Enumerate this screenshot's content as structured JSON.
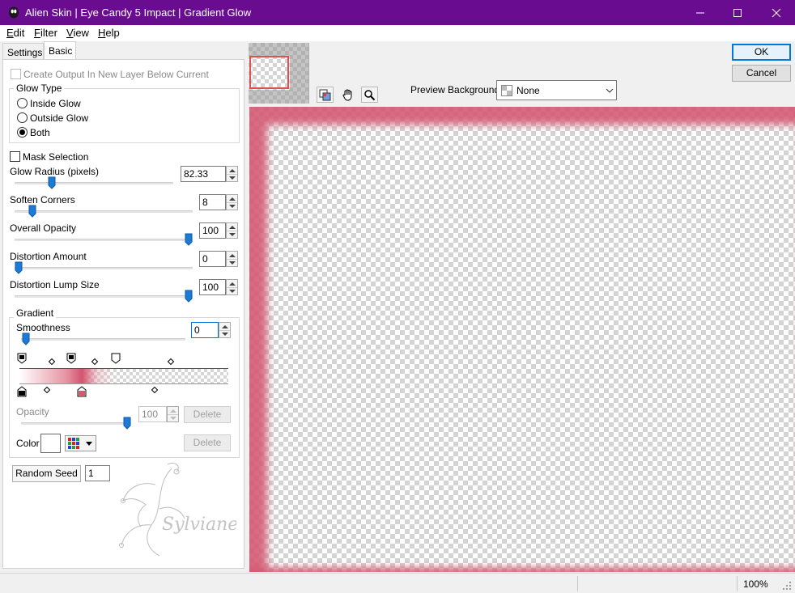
{
  "window": {
    "title": "Alien Skin | Eye Candy 5 Impact | Gradient Glow",
    "titlebar_color": "#6a0c8f"
  },
  "menu": [
    "Edit",
    "Filter",
    "View",
    "Help"
  ],
  "tabs": [
    "Settings",
    "Basic"
  ],
  "basic": {
    "create_output_label": "Create Output In New Layer Below Current",
    "glow_type": {
      "title": "Glow Type",
      "options": [
        "Inside Glow",
        "Outside Glow",
        "Both"
      ],
      "selected": "Both"
    },
    "mask_selection_label": "Mask Selection",
    "sliders": [
      {
        "label": "Glow Radius (pixels)",
        "value": "82.33",
        "fraction": 0.22
      },
      {
        "label": "Soften Corners",
        "value": "8",
        "fraction": 0.08
      },
      {
        "label": "Overall Opacity",
        "value": "100",
        "fraction": 1.0
      },
      {
        "label": "Distortion Amount",
        "value": "0",
        "fraction": 0.0
      },
      {
        "label": "Distortion Lump Size",
        "value": "100",
        "fraction": 1.0
      }
    ],
    "gradient": {
      "title": "Gradient",
      "smoothness_label": "Smoothness",
      "smoothness_value": "0",
      "smoothness_fraction": 0.0,
      "opacity_label": "Opacity",
      "opacity_value": "100",
      "opacity_fraction": 1.0,
      "delete_label": "Delete",
      "color_label": "Color",
      "stop_color": "#d8566e"
    },
    "random_seed_label": "Random Seed",
    "random_seed_value": "1"
  },
  "watermark_text": "Sylviane",
  "buttons": {
    "ok": "OK",
    "cancel": "Cancel"
  },
  "preview_background": {
    "label": "Preview Background:",
    "value": "None"
  },
  "glow_color": "#d45a73",
  "status": {
    "zoom": "100%"
  }
}
